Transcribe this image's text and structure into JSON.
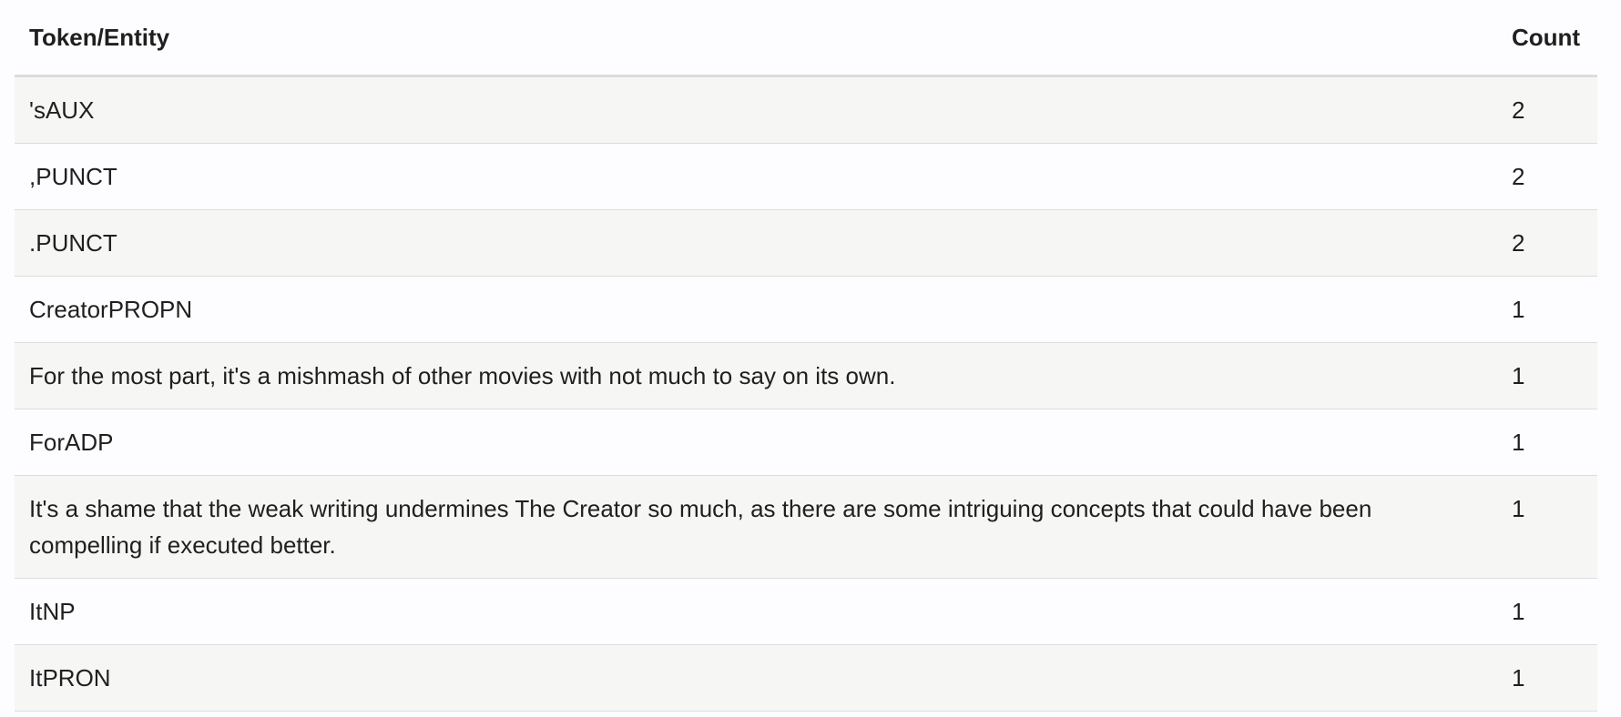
{
  "table": {
    "headers": {
      "token": "Token/Entity",
      "count": "Count"
    },
    "rows": [
      {
        "token": "'sAUX",
        "count": "2"
      },
      {
        "token": ",PUNCT",
        "count": "2"
      },
      {
        "token": ".PUNCT",
        "count": "2"
      },
      {
        "token": "CreatorPROPN",
        "count": "1"
      },
      {
        "token": "For the most part, it's a mishmash of other movies with not much to say on its own.",
        "count": "1"
      },
      {
        "token": "ForADP",
        "count": "1"
      },
      {
        "token": "It's a shame that the weak writing undermines The Creator so much, as there are some intriguing concepts that could have been compelling if executed better.",
        "count": "1"
      },
      {
        "token": "ItNP",
        "count": "1"
      },
      {
        "token": "ItPRON",
        "count": "1"
      }
    ]
  }
}
